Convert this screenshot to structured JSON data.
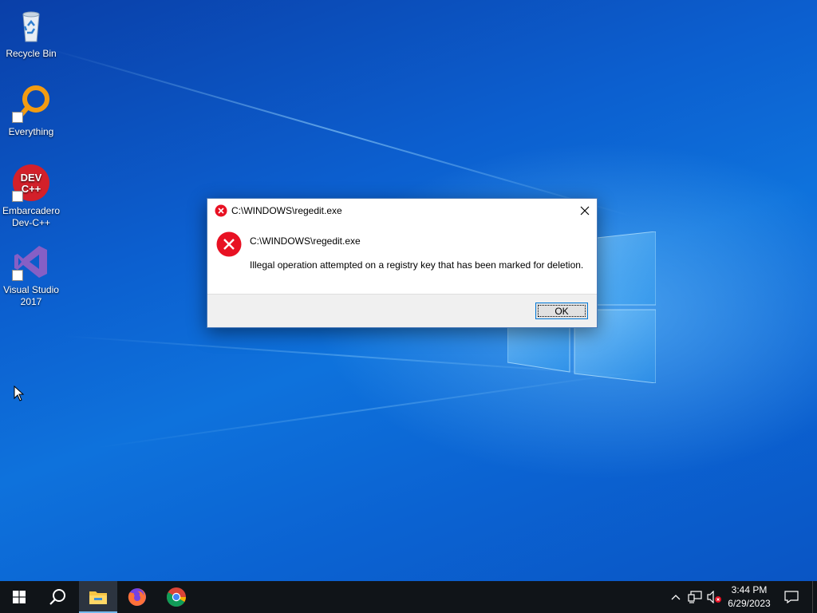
{
  "desktop": {
    "icons": [
      {
        "label": "Recycle Bin",
        "icon": "recycle-bin-icon"
      },
      {
        "label": "Everything",
        "icon": "everything-search-icon"
      },
      {
        "label": "Embarcadero Dev-C++",
        "icon": "devcpp-icon",
        "icon_text_top": "DEV",
        "icon_text_bottom": "C++"
      },
      {
        "label": "Visual Studio 2017",
        "icon": "visual-studio-icon"
      }
    ]
  },
  "dialog": {
    "title": "C:\\WINDOWS\\regedit.exe",
    "heading": "C:\\WINDOWS\\regedit.exe",
    "message": "Illegal operation attempted on a registry key that has been marked for deletion.",
    "ok_label": "OK",
    "icon": "error-icon",
    "close_icon": "close-icon"
  },
  "taskbar": {
    "start_icon": "windows-start-icon",
    "search_icon": "search-icon",
    "pinned": [
      {
        "name": "File Explorer",
        "icon": "file-explorer-icon",
        "active": true
      },
      {
        "name": "Firefox",
        "icon": "firefox-icon",
        "active": false
      },
      {
        "name": "Chrome",
        "icon": "chrome-icon",
        "active": false
      }
    ],
    "tray": {
      "chevron_icon": "chevron-up-icon",
      "network_icon": "network-icon",
      "volume_icon": "volume-muted-icon",
      "time": "3:44 PM",
      "date": "6/29/2023",
      "notification_icon": "notification-icon"
    }
  },
  "colors": {
    "accent": "#0078d7",
    "error_red": "#e81123",
    "taskbar_bg": "#101418"
  }
}
